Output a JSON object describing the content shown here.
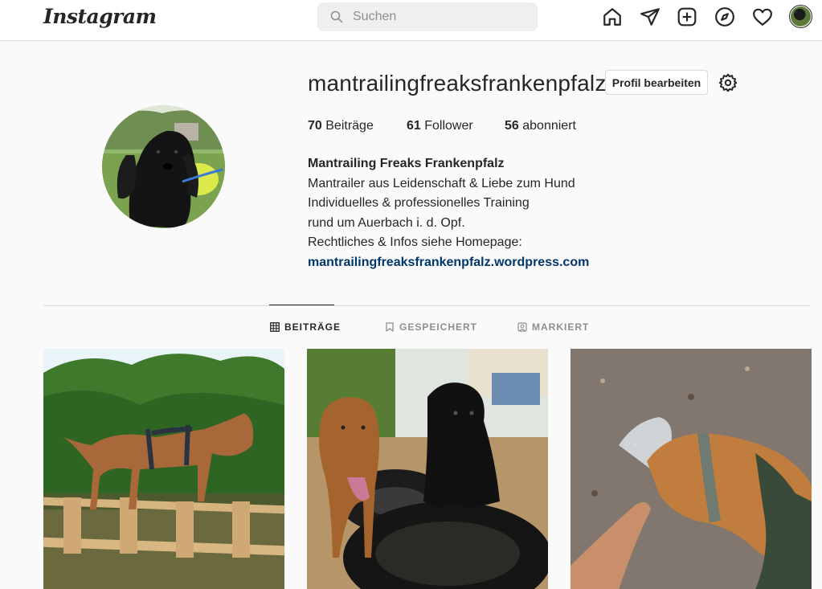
{
  "nav": {
    "logo": "Instagram",
    "search_placeholder": "Suchen",
    "icons": [
      "home-icon",
      "direct-icon",
      "new-post-icon",
      "explore-icon",
      "activity-icon",
      "profile-avatar"
    ]
  },
  "profile": {
    "username": "mantrailingfreaksfrankenpfalz",
    "edit_button": "Profil bearbeiten",
    "stats": {
      "posts_count": "70",
      "posts_label": "Beiträge",
      "followers_count": "61",
      "followers_label": "Follower",
      "following_count": "56",
      "following_label": "abonniert"
    },
    "bio": {
      "name": "Mantrailing Freaks Frankenpfalz",
      "lines": [
        "Mantrailer aus Leidenschaft & Liebe zum Hund",
        "Individuelles & professionelles Training",
        "rund um Auerbach i. d. Opf.",
        "Rechtliches & Infos siehe Homepage:"
      ],
      "link": "mantrailingfreaksfrankenpfalz.wordpress.com"
    }
  },
  "tabs": [
    {
      "label": "BEITRÄGE",
      "active": true
    },
    {
      "label": "GESPEICHERT",
      "active": false
    },
    {
      "label": "MARKIERT",
      "active": false
    }
  ],
  "posts": [
    {
      "subject": "dog-on-wooden-pallet"
    },
    {
      "subject": "two-dogs-on-tires"
    },
    {
      "subject": "dog-sniffing-bag"
    }
  ],
  "colors": {
    "background": "#fafafa",
    "border": "#dbdbdb",
    "text": "#262626",
    "muted": "#8e8e8e",
    "link": "#00376b"
  }
}
